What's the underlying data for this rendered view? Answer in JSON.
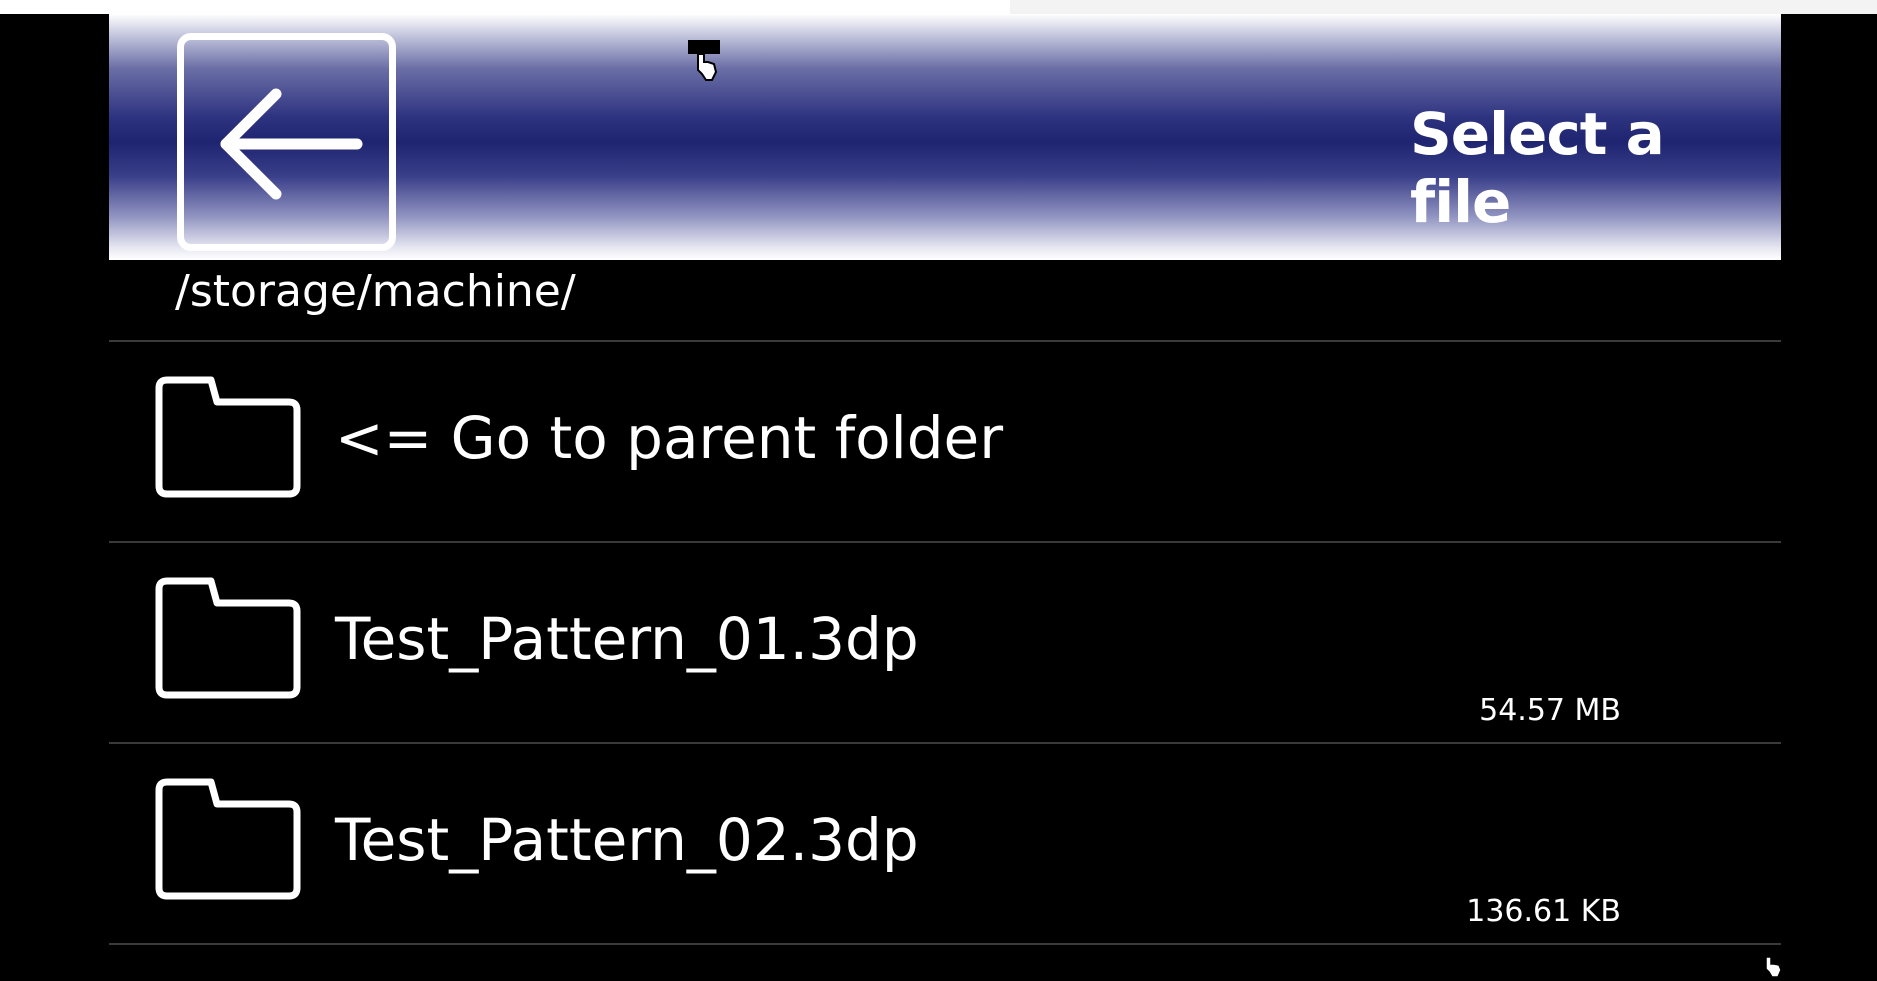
{
  "header": {
    "title": "Select a file",
    "back_icon": "arrow-left-icon"
  },
  "path": "/storage/machine/",
  "files": [
    {
      "name": "<= Go to parent folder",
      "size": "",
      "icon": "folder-icon"
    },
    {
      "name": "Test_Pattern_01.3dp",
      "size": "54.57 MB",
      "icon": "folder-icon"
    },
    {
      "name": "Test_Pattern_02.3dp",
      "size": "136.61 KB",
      "icon": "folder-icon"
    }
  ],
  "colors": {
    "header_dark": "#1f2470",
    "background": "#000000",
    "text": "#ffffff"
  }
}
